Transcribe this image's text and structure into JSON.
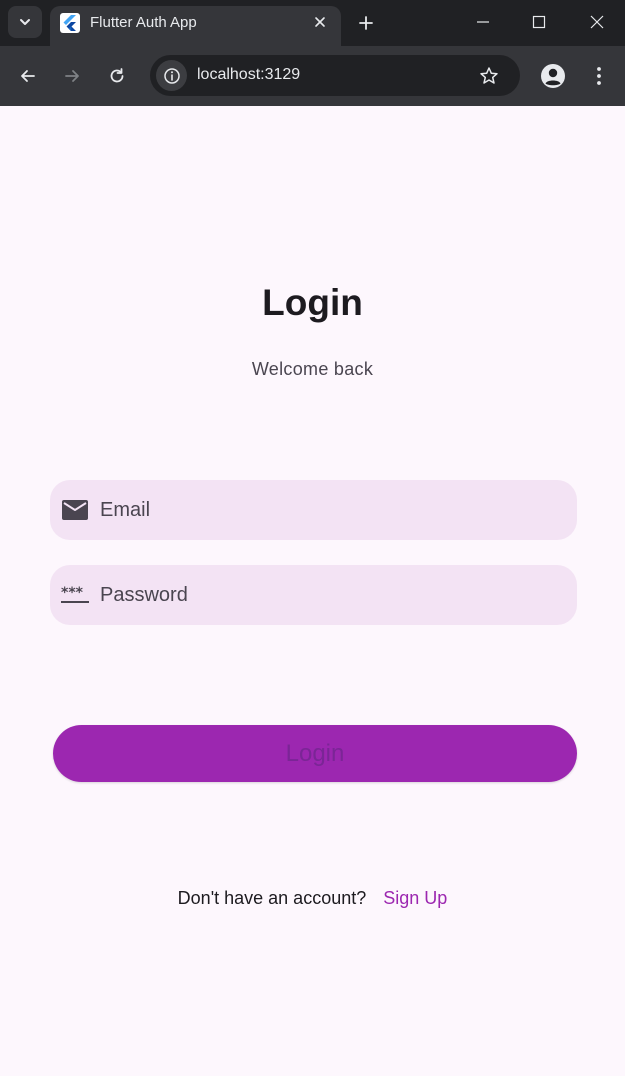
{
  "browser": {
    "tab_title": "Flutter Auth App",
    "url": "localhost:3129",
    "icons": {
      "tab_search": "chevron-down-icon",
      "favicon": "flutter-logo-icon",
      "close_tab": "close-icon",
      "new_tab": "plus-icon",
      "minimize": "minimize-icon",
      "maximize": "maximize-icon",
      "close_window": "close-icon",
      "back": "arrow-left-icon",
      "forward": "arrow-right-icon",
      "reload": "reload-icon",
      "site_info": "info-icon",
      "bookmark": "star-icon",
      "profile": "profile-icon",
      "menu": "kebab-menu-icon"
    }
  },
  "login": {
    "title": "Login",
    "subtitle": "Welcome back",
    "email": {
      "placeholder": "Email",
      "value": "",
      "icon": "mail-icon"
    },
    "password": {
      "placeholder": "Password",
      "value": "",
      "icon": "password-icon"
    },
    "button_label": "Login",
    "signup_prompt": "Don't have an account?",
    "signup_link": "Sign Up"
  },
  "colors": {
    "page_background": "#fdf7fd",
    "field_background": "#f3e3f4",
    "primary": "#9c27b0",
    "text": "#1d1b20",
    "muted_text": "#4a4550"
  }
}
